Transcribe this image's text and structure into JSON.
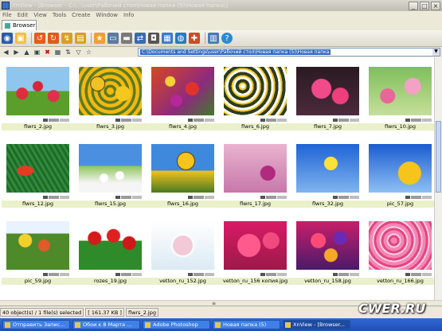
{
  "titlebar": {
    "title": "XnView - [Browser - C:\\...\\user\\Рабочий стол\\Новая папка (5)\\Новая папка\\]"
  },
  "menu": [
    "File",
    "Edit",
    "View",
    "Tools",
    "Create",
    "Window",
    "Info"
  ],
  "tabs": [
    {
      "label": "Browser"
    }
  ],
  "address": {
    "path": "C:\\Documents and Settings\\user\\Рабочий стол\\Новая папка (5)\\Новая папка"
  },
  "thumbnails": [
    {
      "name": "flwrs_2.jpg",
      "icon": "flower-photo"
    },
    {
      "name": "flwrs_3.jpg",
      "icon": "flower-photo"
    },
    {
      "name": "flwrs_4.jpg",
      "icon": "flower-photo"
    },
    {
      "name": "flwrs_6.jpg",
      "icon": "flower-photo"
    },
    {
      "name": "flwrs_7.jpg",
      "icon": "flower-photo"
    },
    {
      "name": "flwrs_10.jpg",
      "icon": "flower-photo"
    },
    {
      "name": "flwrs_12.jpg",
      "icon": "flower-photo"
    },
    {
      "name": "flwrs_15.jpg",
      "icon": "flower-photo"
    },
    {
      "name": "flwrs_16.jpg",
      "icon": "flower-photo"
    },
    {
      "name": "flwrs_17.jpg",
      "icon": "flower-photo"
    },
    {
      "name": "flwrs_32.jpg",
      "icon": "flower-photo"
    },
    {
      "name": "pic_57.jpg",
      "icon": "flower-photo"
    },
    {
      "name": "pic_59.jpg",
      "icon": "flower-photo"
    },
    {
      "name": "rozes_19.jpg",
      "icon": "flower-photo"
    },
    {
      "name": "vetton_ru_152.jpg",
      "icon": "flower-photo"
    },
    {
      "name": "vetton_ru_156 копия.jpg",
      "icon": "flower-photo"
    },
    {
      "name": "vetton_ru_158.jpg",
      "icon": "flower-photo"
    },
    {
      "name": "vetton_ru_166.jpg",
      "icon": "flower-photo"
    }
  ],
  "status": {
    "objects": "40 object(s) / 1 file(s) selected",
    "size": "[ 161.37 KB ]",
    "file": "flwrs_2.jpg"
  },
  "taskbar": {
    "items": [
      "Отправить Запис...",
      "Обои к 8 Марта ...",
      "Adobe Photoshop",
      "Новая папка (5)",
      "XnView - [Browser..."
    ]
  },
  "watermark": "CWER.RU"
}
